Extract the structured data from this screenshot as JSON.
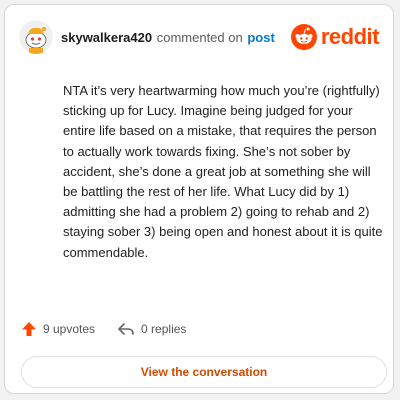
{
  "comment": {
    "username": "skywalkera420",
    "action_text": "commented on",
    "post_link_label": "post",
    "body": "NTA it’s very heartwarming how much you’re (rightfully) sticking up for Lucy. Imagine being judged for your entire life based on a mistake, that requires the person to actually work towards fixing. She’s not sober by accident, she’s done a great job at something she will be battling the rest of her life. What Lucy did by 1) admitting she had a problem 2) going to rehab and 2) staying sober 3) being open and honest about it is quite commendable.",
    "upvotes_label": "9 upvotes",
    "replies_label": "0 replies"
  },
  "brand": {
    "name": "reddit",
    "color": "#ff4500"
  },
  "cta": {
    "label": "View the conversation",
    "color": "#d14a00"
  },
  "icons": {
    "avatar": "snoo-avatar",
    "logo": "reddit-logo-icon",
    "upvote": "upvote-arrow-icon",
    "reply": "reply-arrow-icon"
  }
}
